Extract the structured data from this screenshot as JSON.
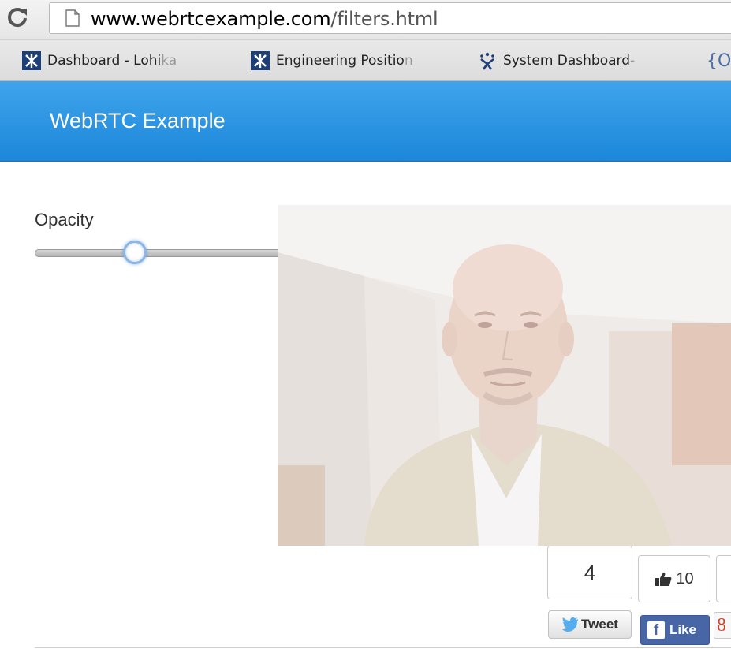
{
  "browser": {
    "url_host": "www.webrtcexample.com",
    "url_path": "/filters.html",
    "bookmarks": [
      {
        "label": "Dashboard - Lohi",
        "label_faded": "ka",
        "icon": "lohika-logo-icon"
      },
      {
        "label": "Engineering Positio",
        "label_faded": "n",
        "icon": "lohika-logo-icon"
      },
      {
        "label": "System Dashboard",
        "label_faded": " -",
        "icon": "jira-logo-icon"
      },
      {
        "label": "{O",
        "label_faded": "",
        "icon": "brace-icon"
      }
    ]
  },
  "navbar": {
    "brand": "WebRTC Example",
    "color": "#2b95e3"
  },
  "controls": {
    "opacity_label": "Opacity",
    "opacity_value_fraction": 0.32
  },
  "video": {
    "description_hidden": "webcam feed with opacity filter"
  },
  "social": {
    "tweet_count": "4",
    "tweet_label": "Tweet",
    "like_count": "10",
    "like_label": "Like",
    "gplus_glyph": "8"
  },
  "colors": {
    "accent": "#2b95e3",
    "facebook": "#4866a6",
    "twitter": "#55acee",
    "gplus": "#d0422d"
  }
}
